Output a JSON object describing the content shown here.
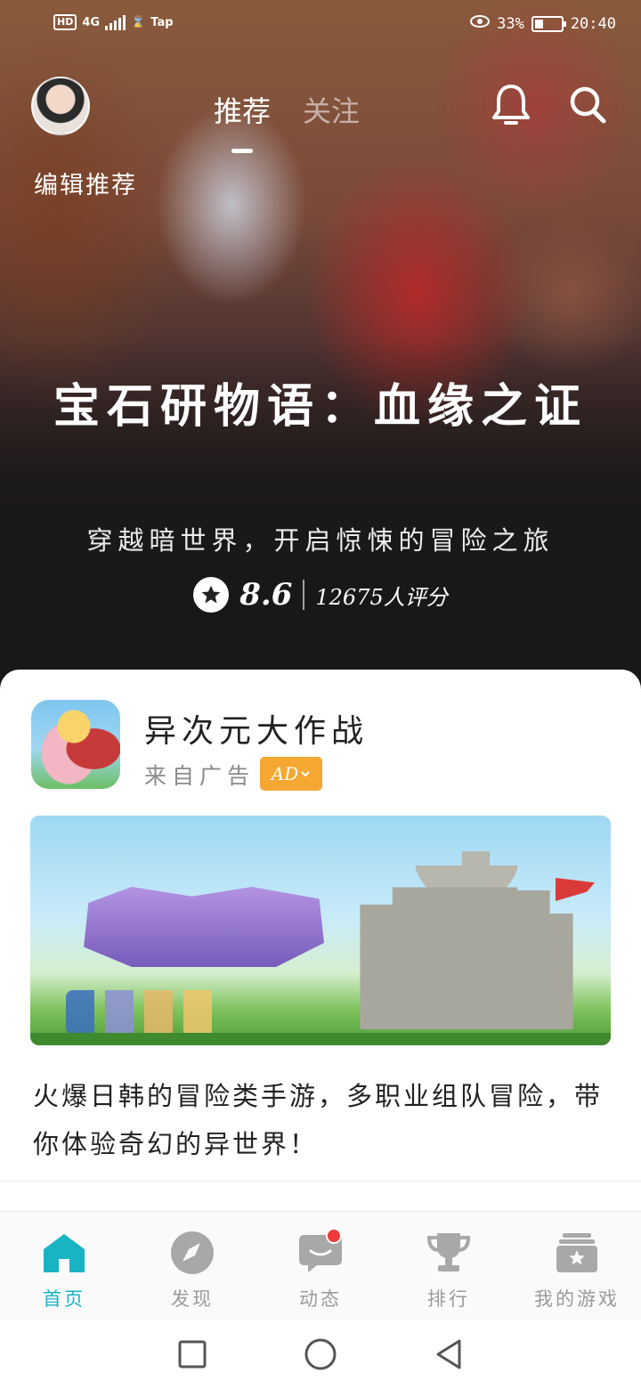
{
  "status_bar": {
    "left": {
      "hd": "HD",
      "network": "4G",
      "extra": "Tap"
    },
    "eye_percent": "33%",
    "time": "20:40"
  },
  "top_nav": {
    "tabs": [
      {
        "label": "推荐",
        "active": true
      },
      {
        "label": "关注",
        "active": false
      }
    ]
  },
  "hero": {
    "tag": "编辑推荐",
    "title": "宝石研物语：血缘之证",
    "subtitle": "穿越暗世界，开启惊悚的冒险之旅",
    "rating": "8.6",
    "rating_count": "12675人评分"
  },
  "ad_card": {
    "app_name": "异次元大作战",
    "source": "来自广告",
    "ad_badge": "AD",
    "description": "火爆日韩的冒险类手游，多职业组队冒险，带你体验奇幻的异世界！"
  },
  "bottom_nav": {
    "items": [
      {
        "label": "首页",
        "icon": "home-icon",
        "active": true
      },
      {
        "label": "发现",
        "icon": "compass-icon",
        "active": false
      },
      {
        "label": "动态",
        "icon": "chat-icon",
        "active": false,
        "badge": true
      },
      {
        "label": "排行",
        "icon": "trophy-icon",
        "active": false
      },
      {
        "label": "我的游戏",
        "icon": "game-library-icon",
        "active": false
      }
    ]
  },
  "colors": {
    "accent": "#19b4c3",
    "ad_badge": "#f4a832",
    "notification": "#ee3b3b"
  }
}
